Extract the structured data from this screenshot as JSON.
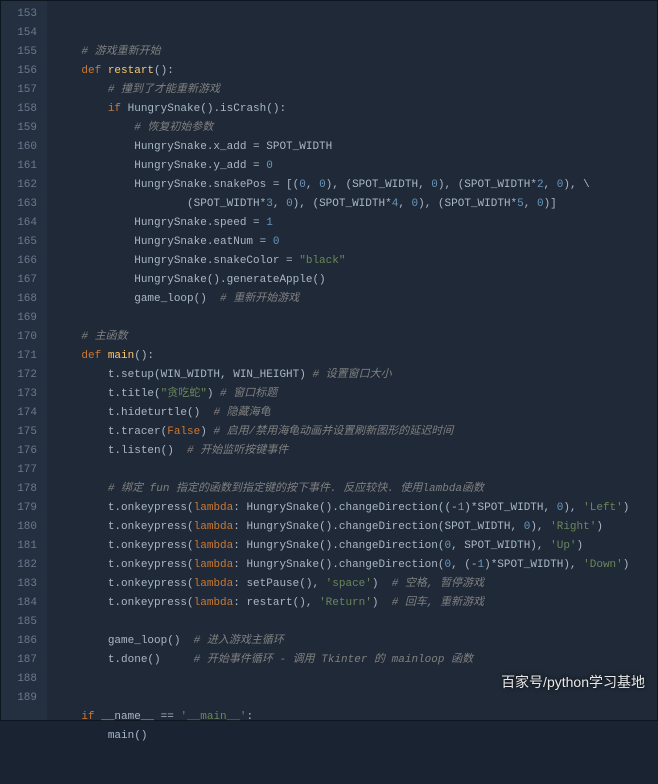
{
  "lines": [
    {
      "n": 153,
      "tokens": [
        {
          "t": "    "
        },
        {
          "t": "# 游戏重新开始",
          "c": "cmt"
        }
      ]
    },
    {
      "n": 154,
      "tokens": [
        {
          "t": "    "
        },
        {
          "t": "def ",
          "c": "kw"
        },
        {
          "t": "restart",
          "c": "def"
        },
        {
          "t": "():"
        }
      ]
    },
    {
      "n": 155,
      "tokens": [
        {
          "t": "        "
        },
        {
          "t": "# 撞到了才能重新游戏",
          "c": "cmt"
        }
      ]
    },
    {
      "n": 156,
      "tokens": [
        {
          "t": "        "
        },
        {
          "t": "if ",
          "c": "kw"
        },
        {
          "t": "HungrySnake().isCrash():"
        }
      ]
    },
    {
      "n": 157,
      "tokens": [
        {
          "t": "            "
        },
        {
          "t": "# 恢复初始参数",
          "c": "cmt"
        }
      ]
    },
    {
      "n": 158,
      "tokens": [
        {
          "t": "            "
        },
        {
          "t": "HungrySnake.x_add = SPOT_WIDTH"
        }
      ]
    },
    {
      "n": 159,
      "tokens": [
        {
          "t": "            "
        },
        {
          "t": "HungrySnake.y_add = "
        },
        {
          "t": "0",
          "c": "num"
        }
      ]
    },
    {
      "n": 160,
      "tokens": [
        {
          "t": "            "
        },
        {
          "t": "HungrySnake.snakePos = [("
        },
        {
          "t": "0",
          "c": "num"
        },
        {
          "t": ", "
        },
        {
          "t": "0",
          "c": "num"
        },
        {
          "t": "), (SPOT_WIDTH, "
        },
        {
          "t": "0",
          "c": "num"
        },
        {
          "t": "), (SPOT_WIDTH*"
        },
        {
          "t": "2",
          "c": "num"
        },
        {
          "t": ", "
        },
        {
          "t": "0",
          "c": "num"
        },
        {
          "t": "), \\"
        }
      ]
    },
    {
      "n": 161,
      "tokens": [
        {
          "t": "                    "
        },
        {
          "t": "(SPOT_WIDTH*"
        },
        {
          "t": "3",
          "c": "num"
        },
        {
          "t": ", "
        },
        {
          "t": "0",
          "c": "num"
        },
        {
          "t": "), (SPOT_WIDTH*"
        },
        {
          "t": "4",
          "c": "num"
        },
        {
          "t": ", "
        },
        {
          "t": "0",
          "c": "num"
        },
        {
          "t": "), (SPOT_WIDTH*"
        },
        {
          "t": "5",
          "c": "num"
        },
        {
          "t": ", "
        },
        {
          "t": "0",
          "c": "num"
        },
        {
          "t": ")]"
        }
      ]
    },
    {
      "n": 162,
      "tokens": [
        {
          "t": "            "
        },
        {
          "t": "HungrySnake.speed = "
        },
        {
          "t": "1",
          "c": "num"
        }
      ]
    },
    {
      "n": 163,
      "tokens": [
        {
          "t": "            "
        },
        {
          "t": "HungrySnake.eatNum = "
        },
        {
          "t": "0",
          "c": "num"
        }
      ]
    },
    {
      "n": 164,
      "tokens": [
        {
          "t": "            "
        },
        {
          "t": "HungrySnake.snakeColor = "
        },
        {
          "t": "\"black\"",
          "c": "str"
        }
      ]
    },
    {
      "n": 165,
      "tokens": [
        {
          "t": "            "
        },
        {
          "t": "HungrySnake().generateApple()"
        }
      ]
    },
    {
      "n": 166,
      "tokens": [
        {
          "t": "            "
        },
        {
          "t": "game_loop()  "
        },
        {
          "t": "# 重新开始游戏",
          "c": "cmt"
        }
      ]
    },
    {
      "n": 167,
      "tokens": [
        {
          "t": ""
        }
      ]
    },
    {
      "n": 168,
      "tokens": [
        {
          "t": "    "
        },
        {
          "t": "# 主函数",
          "c": "cmt"
        }
      ]
    },
    {
      "n": 169,
      "tokens": [
        {
          "t": "    "
        },
        {
          "t": "def ",
          "c": "kw"
        },
        {
          "t": "main",
          "c": "def"
        },
        {
          "t": "():"
        }
      ]
    },
    {
      "n": 170,
      "tokens": [
        {
          "t": "        "
        },
        {
          "t": "t.setup(WIN_WIDTH, WIN_HEIGHT) "
        },
        {
          "t": "# 设置窗口大小",
          "c": "cmt"
        }
      ]
    },
    {
      "n": 171,
      "tokens": [
        {
          "t": "        "
        },
        {
          "t": "t.title("
        },
        {
          "t": "\"贪吃蛇\"",
          "c": "str"
        },
        {
          "t": ") "
        },
        {
          "t": "# 窗口标题",
          "c": "cmt"
        }
      ]
    },
    {
      "n": 172,
      "tokens": [
        {
          "t": "        "
        },
        {
          "t": "t.hideturtle()  "
        },
        {
          "t": "# 隐藏海龟",
          "c": "cmt"
        }
      ]
    },
    {
      "n": 173,
      "tokens": [
        {
          "t": "        "
        },
        {
          "t": "t.tracer("
        },
        {
          "t": "False",
          "c": "bool"
        },
        {
          "t": ") "
        },
        {
          "t": "# 启用/禁用海龟动画并设置刷新图形的延迟时间",
          "c": "cmt"
        }
      ]
    },
    {
      "n": 174,
      "tokens": [
        {
          "t": "        "
        },
        {
          "t": "t.listen()  "
        },
        {
          "t": "# 开始监听按键事件",
          "c": "cmt"
        }
      ]
    },
    {
      "n": 175,
      "tokens": [
        {
          "t": ""
        }
      ]
    },
    {
      "n": 176,
      "tokens": [
        {
          "t": "        "
        },
        {
          "t": "# 绑定 fun 指定的函数到指定键的按下事件. 反应较快. 使用lambda函数",
          "c": "cmt"
        }
      ]
    },
    {
      "n": 177,
      "tokens": [
        {
          "t": "        "
        },
        {
          "t": "t.onkeypress("
        },
        {
          "t": "lambda",
          "c": "kw"
        },
        {
          "t": ": HungrySnake().changeDirection((-"
        },
        {
          "t": "1",
          "c": "num"
        },
        {
          "t": ")*SPOT_WIDTH, "
        },
        {
          "t": "0",
          "c": "num"
        },
        {
          "t": "), "
        },
        {
          "t": "'Left'",
          "c": "str"
        },
        {
          "t": ")"
        }
      ]
    },
    {
      "n": 178,
      "tokens": [
        {
          "t": "        "
        },
        {
          "t": "t.onkeypress("
        },
        {
          "t": "lambda",
          "c": "kw"
        },
        {
          "t": ": HungrySnake().changeDirection(SPOT_WIDTH, "
        },
        {
          "t": "0",
          "c": "num"
        },
        {
          "t": "), "
        },
        {
          "t": "'Right'",
          "c": "str"
        },
        {
          "t": ")"
        }
      ]
    },
    {
      "n": 179,
      "tokens": [
        {
          "t": "        "
        },
        {
          "t": "t.onkeypress("
        },
        {
          "t": "lambda",
          "c": "kw"
        },
        {
          "t": ": HungrySnake().changeDirection("
        },
        {
          "t": "0",
          "c": "num"
        },
        {
          "t": ", SPOT_WIDTH), "
        },
        {
          "t": "'Up'",
          "c": "str"
        },
        {
          "t": ")"
        }
      ]
    },
    {
      "n": 180,
      "tokens": [
        {
          "t": "        "
        },
        {
          "t": "t.onkeypress("
        },
        {
          "t": "lambda",
          "c": "kw"
        },
        {
          "t": ": HungrySnake().changeDirection("
        },
        {
          "t": "0",
          "c": "num"
        },
        {
          "t": ", (-"
        },
        {
          "t": "1",
          "c": "num"
        },
        {
          "t": ")*SPOT_WIDTH), "
        },
        {
          "t": "'Down'",
          "c": "str"
        },
        {
          "t": ")"
        }
      ]
    },
    {
      "n": 181,
      "tokens": [
        {
          "t": "        "
        },
        {
          "t": "t.onkeypress("
        },
        {
          "t": "lambda",
          "c": "kw"
        },
        {
          "t": ": setPause(), "
        },
        {
          "t": "'space'",
          "c": "str"
        },
        {
          "t": ")  "
        },
        {
          "t": "# 空格, 暂停游戏",
          "c": "cmt"
        }
      ]
    },
    {
      "n": 182,
      "tokens": [
        {
          "t": "        "
        },
        {
          "t": "t.onkeypress("
        },
        {
          "t": "lambda",
          "c": "kw"
        },
        {
          "t": ": restart(), "
        },
        {
          "t": "'Return'",
          "c": "str"
        },
        {
          "t": ")  "
        },
        {
          "t": "# 回车, 重新游戏",
          "c": "cmt"
        }
      ]
    },
    {
      "n": 183,
      "tokens": [
        {
          "t": ""
        }
      ]
    },
    {
      "n": 184,
      "tokens": [
        {
          "t": "        "
        },
        {
          "t": "game_loop()  "
        },
        {
          "t": "# 进入游戏主循环",
          "c": "cmt"
        }
      ]
    },
    {
      "n": 185,
      "tokens": [
        {
          "t": "        "
        },
        {
          "t": "t.done()     "
        },
        {
          "t": "# 开始事件循环 - 调用 Tkinter 的 mainloop 函数",
          "c": "cmt"
        }
      ]
    },
    {
      "n": 186,
      "tokens": [
        {
          "t": ""
        }
      ]
    },
    {
      "n": 187,
      "tokens": [
        {
          "t": ""
        }
      ]
    },
    {
      "n": 188,
      "tokens": [
        {
          "t": "    "
        },
        {
          "t": "if ",
          "c": "kw"
        },
        {
          "t": "__name__ == "
        },
        {
          "t": "'__main__'",
          "c": "str"
        },
        {
          "t": ":"
        }
      ]
    },
    {
      "n": 189,
      "tokens": [
        {
          "t": "        "
        },
        {
          "t": "main()"
        }
      ]
    }
  ],
  "watermark": "百家号/python学习基地"
}
